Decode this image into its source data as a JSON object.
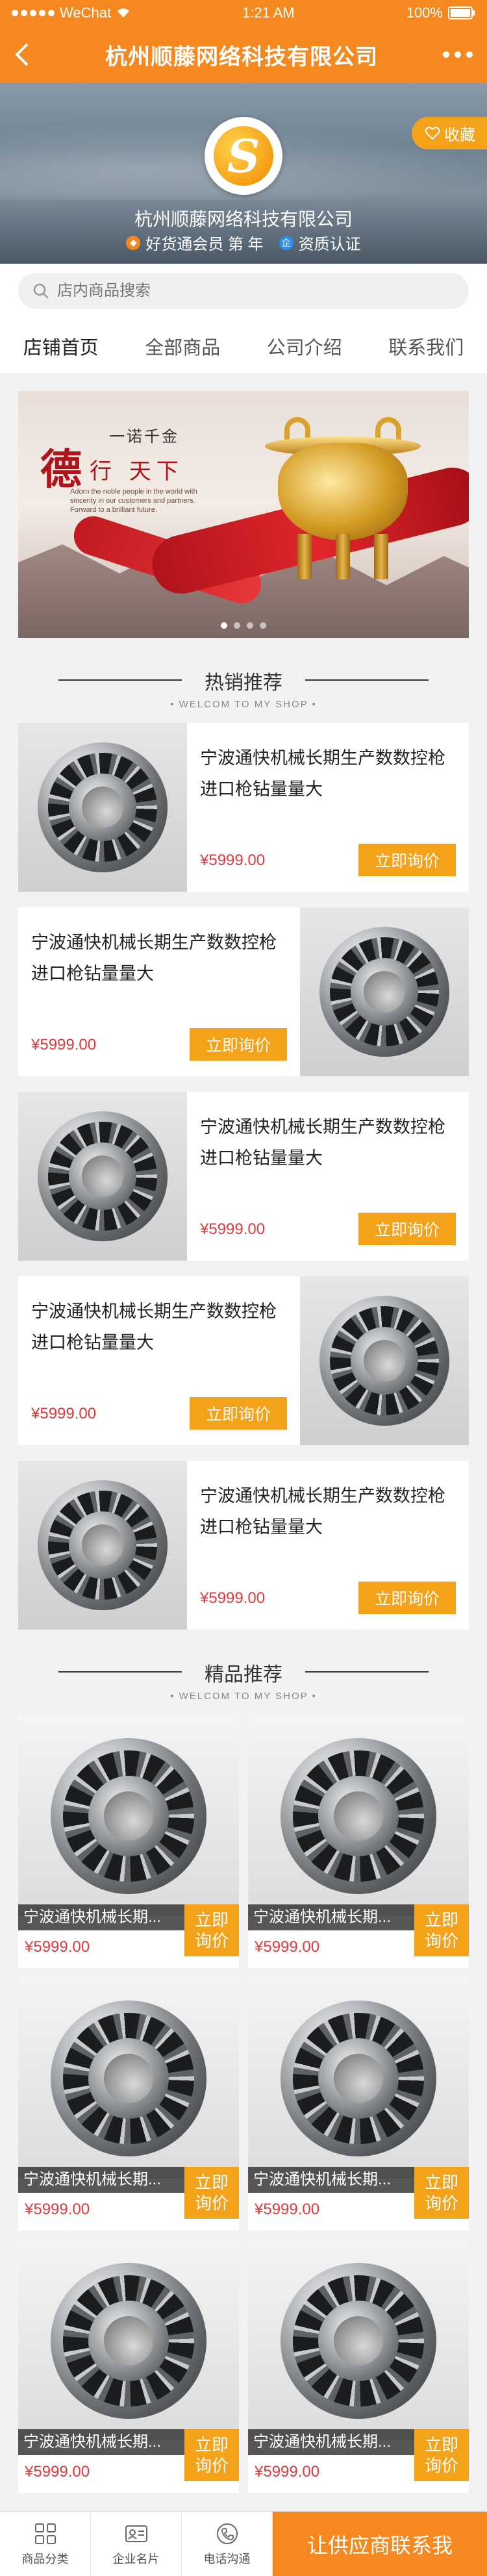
{
  "status": {
    "carrier": "WeChat",
    "time": "1:21 AM",
    "battery": "100%"
  },
  "nav": {
    "title": "杭州顺藤网络科技有限公司"
  },
  "shop": {
    "name": "杭州顺藤网络科技有限公司",
    "favorite_label": "收藏",
    "member_label": "好货通会员 第  年",
    "cert_label": "资质认证",
    "logo_letter": "S"
  },
  "search": {
    "placeholder": "店内商品搜索"
  },
  "tabs": [
    {
      "label": "店铺首页"
    },
    {
      "label": "全部商品"
    },
    {
      "label": "公司介绍"
    },
    {
      "label": "联系我们"
    }
  ],
  "banner": {
    "slogan_small": "一诺千金",
    "slogan_big": "德",
    "slogan_mid": "行 天下",
    "slogan_en": "Adorn the noble people in the world with sincerity in our customers and partners. Forward to a brilliant future."
  },
  "hot_section": {
    "title": "热销推荐",
    "subtitle": "WELCOM TO MY SHOP"
  },
  "hot_items": [
    {
      "name": "宁波通快机械长期生产数数控枪进口枪钻量量大",
      "price": "¥5999.00",
      "button": "立即询价"
    },
    {
      "name": "宁波通快机械长期生产数数控枪进口枪钻量量大",
      "price": "¥5999.00",
      "button": "立即询价"
    },
    {
      "name": "宁波通快机械长期生产数数控枪进口枪钻量量大",
      "price": "¥5999.00",
      "button": "立即询价"
    },
    {
      "name": "宁波通快机械长期生产数数控枪进口枪钻量量大",
      "price": "¥5999.00",
      "button": "立即询价"
    },
    {
      "name": "宁波通快机械长期生产数数控枪进口枪钻量量大",
      "price": "¥5999.00",
      "button": "立即询价"
    }
  ],
  "premium_section": {
    "title": "精品推荐",
    "subtitle": "WELCOM TO MY SHOP"
  },
  "premium_items": [
    {
      "name": "宁波通快机械长期...",
      "price": "¥5999.00",
      "button": "立即询价"
    },
    {
      "name": "宁波通快机械长期...",
      "price": "¥5999.00",
      "button": "立即询价"
    },
    {
      "name": "宁波通快机械长期...",
      "price": "¥5999.00",
      "button": "立即询价"
    },
    {
      "name": "宁波通快机械长期...",
      "price": "¥5999.00",
      "button": "立即询价"
    },
    {
      "name": "宁波通快机械长期...",
      "price": "¥5999.00",
      "button": "立即询价"
    },
    {
      "name": "宁波通快机械长期...",
      "price": "¥5999.00",
      "button": "立即询价"
    }
  ],
  "footer": {
    "items": [
      {
        "label": "商品分类",
        "icon": "grid-icon"
      },
      {
        "label": "企业名片",
        "icon": "id-card-icon"
      },
      {
        "label": "电话沟通",
        "icon": "phone-icon"
      }
    ],
    "cta": "让供应商联系我"
  },
  "colors": {
    "brand": "#f5891f",
    "button": "#f5a21b",
    "price": "#e4393c"
  }
}
